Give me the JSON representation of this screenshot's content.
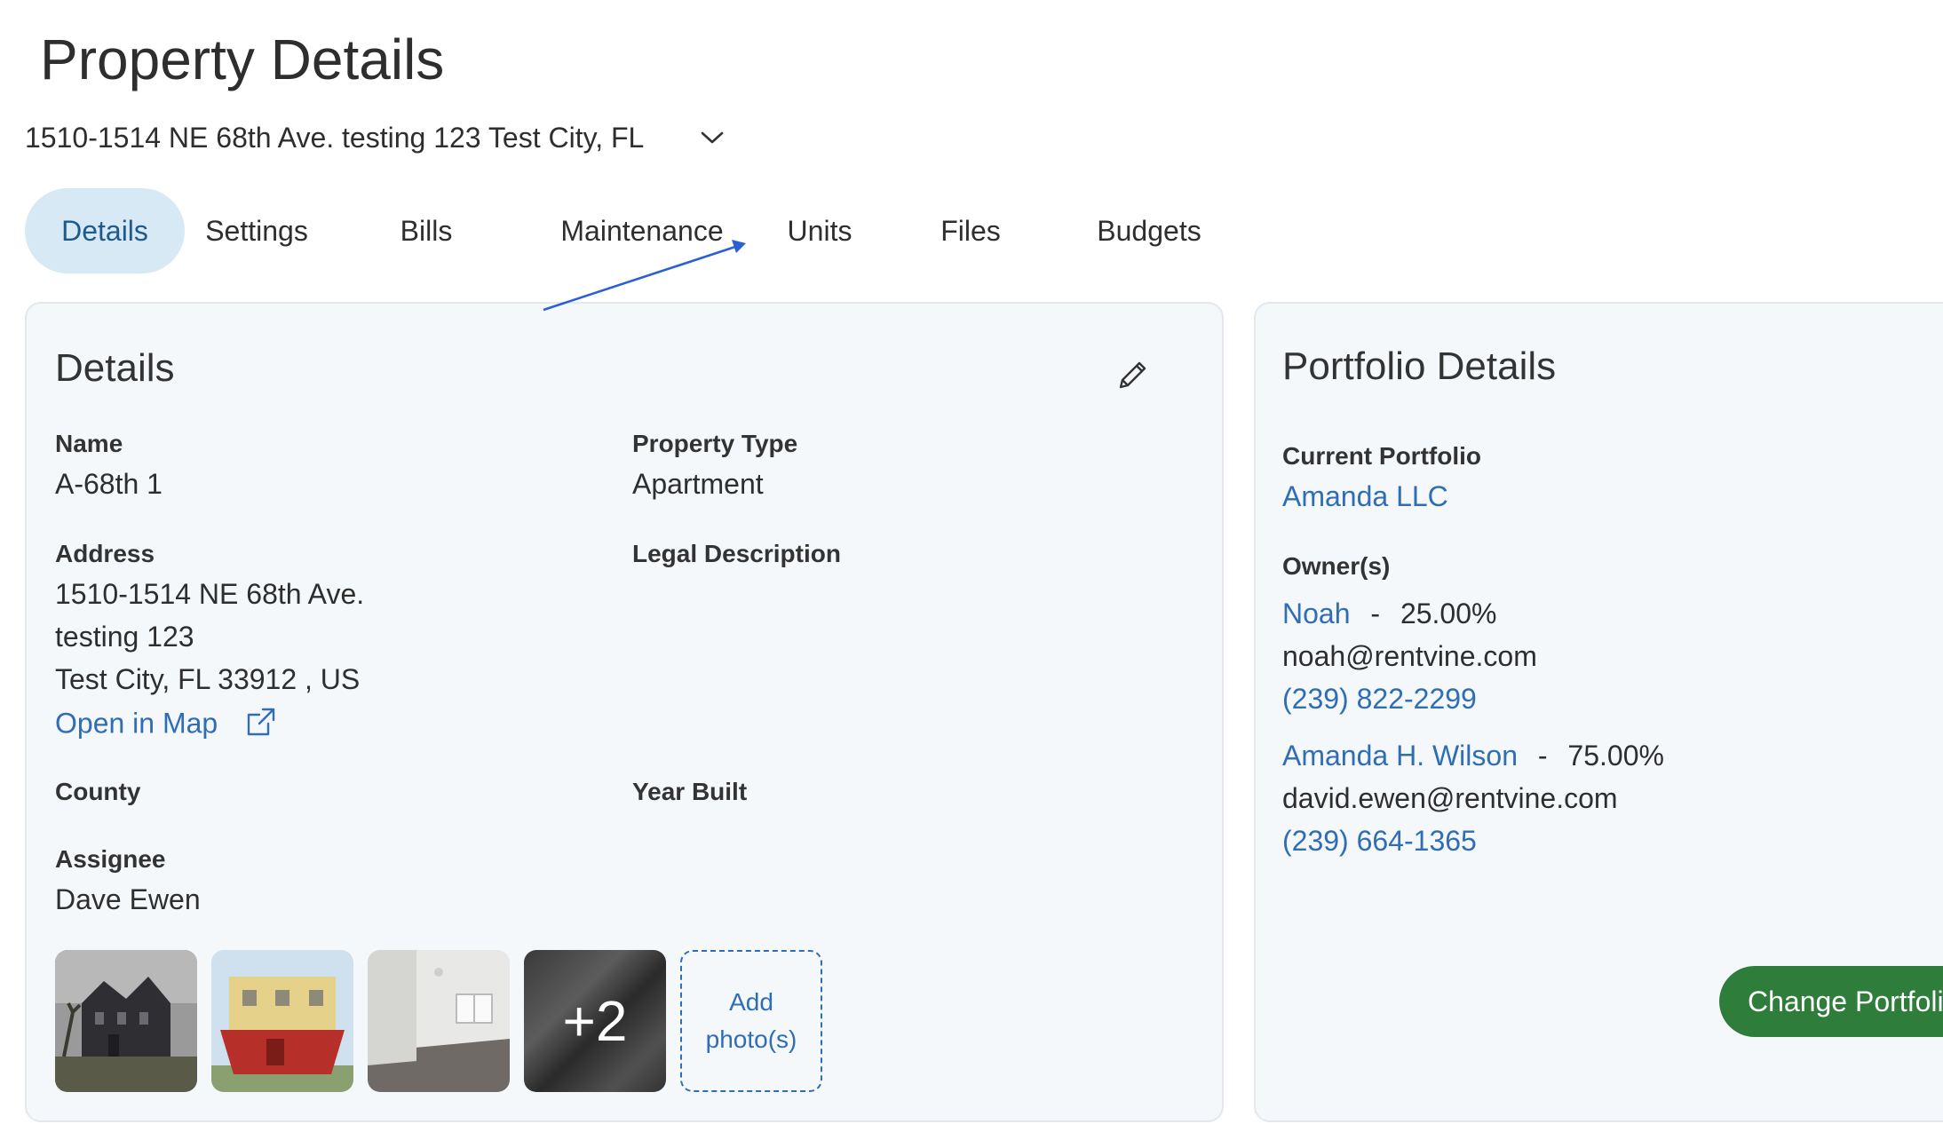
{
  "page": {
    "title": "Property Details",
    "selected_address": "1510-1514 NE 68th Ave. testing 123 Test City, FL"
  },
  "tabs": [
    {
      "label": "Details",
      "active": true
    },
    {
      "label": "Settings",
      "active": false
    },
    {
      "label": "Bills",
      "active": false
    },
    {
      "label": "Maintenance",
      "active": false
    },
    {
      "label": "Units",
      "active": false
    },
    {
      "label": "Files",
      "active": false
    },
    {
      "label": "Budgets",
      "active": false
    }
  ],
  "details": {
    "title": "Details",
    "name_label": "Name",
    "name_value": "A-68th 1",
    "property_type_label": "Property Type",
    "property_type_value": "Apartment",
    "address_label": "Address",
    "address_line1": "1510-1514 NE 68th Ave.",
    "address_line2": "testing 123",
    "address_line3": "Test City, FL 33912 , US",
    "open_map_label": "Open in Map",
    "legal_description_label": "Legal Description",
    "county_label": "County",
    "year_built_label": "Year Built",
    "assignee_label": "Assignee",
    "assignee_value": "Dave Ewen",
    "photos_more": "+2",
    "add_photo_line1": "Add",
    "add_photo_line2": "photo(s)"
  },
  "portfolio": {
    "title": "Portfolio Details",
    "current_label": "Current Portfolio",
    "current_value": "Amanda LLC",
    "owners_label": "Owner(s)",
    "owners": [
      {
        "name": "Noah",
        "separator": "-",
        "share": "25.00%",
        "email": "noah@rentvine.com",
        "phone": "(239) 822-2299"
      },
      {
        "name": "Amanda H. Wilson",
        "separator": "-",
        "share": "75.00%",
        "email": "david.ewen@rentvine.com",
        "phone": "(239) 664-1365"
      }
    ],
    "change_button": "Change Portfolio"
  },
  "colors": {
    "accent": "#2f6db5",
    "active_tab_bg": "#d8e9f6",
    "button_green": "#2e7d3a",
    "card_bg": "#f5f8fb"
  }
}
